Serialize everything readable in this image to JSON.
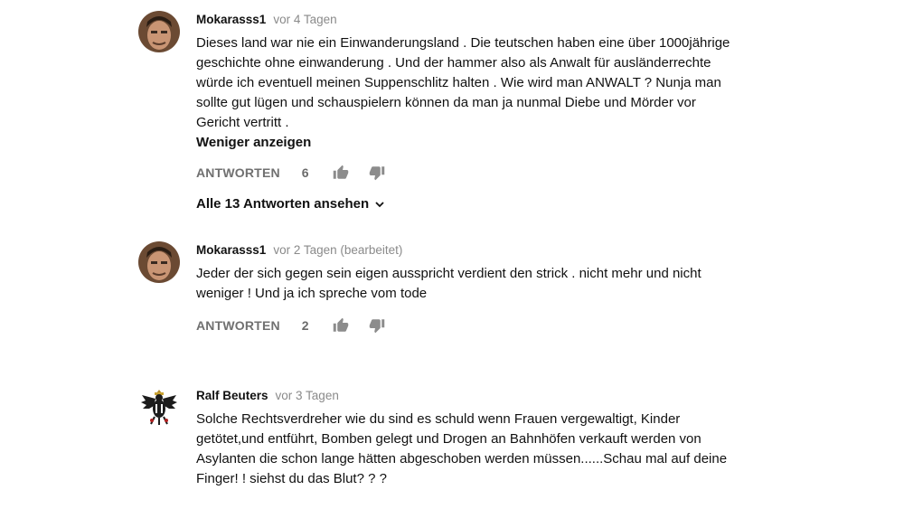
{
  "comments": [
    {
      "author": "Mokarasss1",
      "time": "vor 4 Tagen",
      "lines": [
        "Dieses land war nie ein Einwanderungsland . Die teutschen haben eine über 1000jährige",
        "geschichte ohne einwanderung . Und der hammer also als Anwalt für ausländerrechte",
        "würde ich eventuell meinen Suppenschlitz halten . Wie wird man ANWALT ? Nunja man",
        "sollte gut lügen und schauspielern können da man ja nunmal Diebe und Mörder vor",
        "Gericht vertritt ."
      ],
      "show_less": "Weniger anzeigen",
      "reply_label": "ANTWORTEN",
      "likes": "6",
      "view_replies": "Alle 13 Antworten ansehen"
    },
    {
      "author": "Mokarasss1",
      "time": "vor 2 Tagen (bearbeitet)",
      "lines": [
        "Jeder der sich gegen sein eigen ausspricht verdient den strick . nicht mehr und nicht",
        "weniger ! Und ja ich spreche vom tode"
      ],
      "reply_label": "ANTWORTEN",
      "likes": "2"
    },
    {
      "author": "Ralf Beuters",
      "time": "vor 3 Tagen",
      "lines": [
        "Solche Rechtsverdreher wie du sind es schuld wenn Frauen vergewaltigt, Kinder",
        "getötet,und entführt, Bomben gelegt und Drogen an Bahnhöfen verkauft werden von",
        "Asylanten die schon lange hätten abgeschoben werden müssen......Schau mal auf deine",
        "Finger! !  siehst du das Blut? ? ?"
      ]
    }
  ],
  "icons": {
    "like": "thumbs-up-icon",
    "dislike": "thumbs-down-icon",
    "expand": "chevron-down-icon"
  }
}
